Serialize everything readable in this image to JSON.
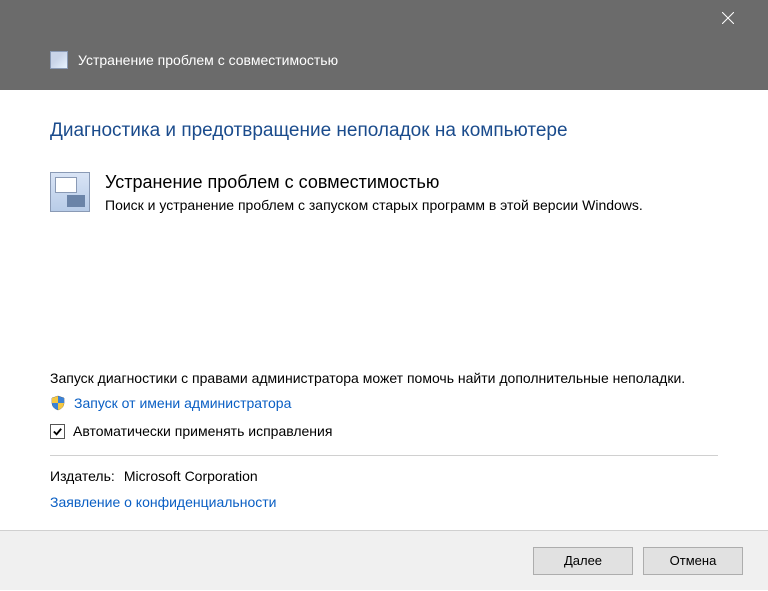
{
  "titlebar": {
    "title": "Устранение проблем с совместимостью"
  },
  "content": {
    "heading": "Диагностика и предотвращение неполадок на компьютере",
    "main_title": "Устранение проблем с совместимостью",
    "main_desc": "Поиск и устранение проблем с запуском старых программ в этой версии Windows.",
    "admin_text": "Запуск диагностики с правами администратора может помочь найти дополнительные неполадки.",
    "admin_link": "Запуск от имени администратора",
    "checkbox_label": "Автоматически применять исправления",
    "publisher_label": "Издатель:",
    "publisher_value": "Microsoft Corporation",
    "privacy_link": "Заявление о конфиденциальности"
  },
  "footer": {
    "next": "Далее",
    "cancel": "Отмена"
  }
}
